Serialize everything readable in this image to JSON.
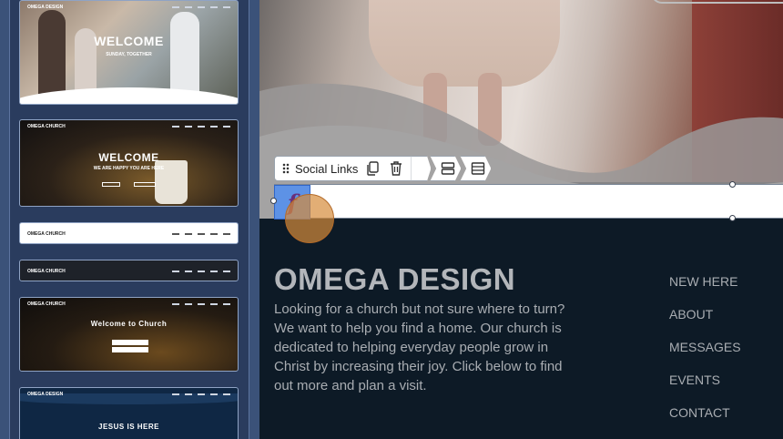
{
  "sidebar": {
    "templates": [
      {
        "logo": "OMEGA DESIGN",
        "title": "WELCOME",
        "subtitle": "SUNDAY, TOGETHER"
      },
      {
        "logo": "OMEGA CHURCH",
        "title": "WELCOME",
        "subtitle": "WE ARE HAPPY YOU ARE HERE"
      },
      {
        "logo": "OMEGA CHURCH"
      },
      {
        "logo": "OMEGA CHURCH"
      },
      {
        "logo": "OMEGA CHURCH",
        "title": "Welcome to Church"
      },
      {
        "logo": "OMEGA DESIGN",
        "title": "JESUS IS HERE"
      }
    ]
  },
  "toolbar": {
    "block_label": "Social Links",
    "icons": [
      "drag-handle-icon",
      "duplicate-icon",
      "delete-icon",
      "rows-icon",
      "section-icon"
    ]
  },
  "social": {
    "icon_letter": "f"
  },
  "footer": {
    "title": "OMEGA DESIGN",
    "text": "Looking for a church but not sure where to turn? We want to help you find a home. Our church is dedicated to helping everyday people grow in Christ by increasing their joy.  Click below to find out more and plan a visit.",
    "nav": [
      "NEW HERE",
      "ABOUT",
      "MESSAGES",
      "EVENTS",
      "CONTACT"
    ]
  },
  "colors": {
    "sidebar_bg": "#3b5279",
    "footer_bg": "#0d1a26",
    "facebook_tile": "#5d92e6",
    "click_marker": "#d68c3a"
  }
}
